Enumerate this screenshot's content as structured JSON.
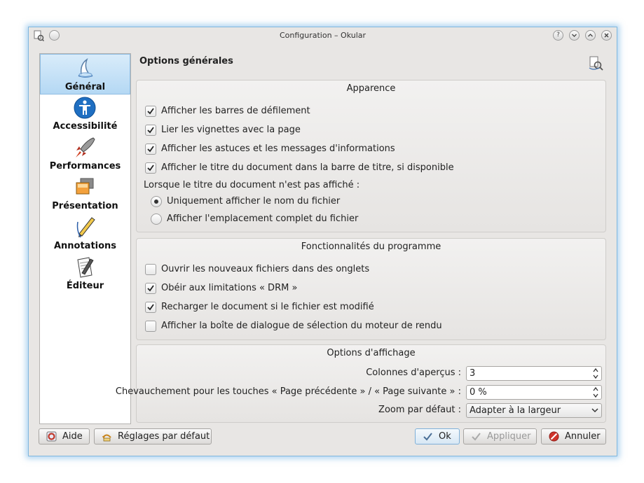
{
  "window": {
    "title": "Configuration – Okular"
  },
  "titlebar_buttons": [
    "help-icon",
    "minimize-icon",
    "maximize-icon",
    "close-icon"
  ],
  "sidebar": {
    "items": [
      {
        "label": "Général",
        "icon": "general-icon",
        "selected": true
      },
      {
        "label": "Accessibilité",
        "icon": "accessibility-icon",
        "selected": false
      },
      {
        "label": "Performances",
        "icon": "rocket-icon",
        "selected": false
      },
      {
        "label": "Présentation",
        "icon": "presentation-icon",
        "selected": false
      },
      {
        "label": "Annotations",
        "icon": "pencil-icon",
        "selected": false
      },
      {
        "label": "Éditeur",
        "icon": "editor-icon",
        "selected": false
      }
    ]
  },
  "page": {
    "title": "Options générales"
  },
  "appearance": {
    "title": "Apparence",
    "checkboxes": [
      {
        "label": "Afficher les barres de défilement",
        "checked": true
      },
      {
        "label": "Lier les vignettes avec la page",
        "checked": true
      },
      {
        "label": "Afficher les astuces et les messages d'informations",
        "checked": true
      },
      {
        "label": "Afficher le titre du document dans la barre de titre, si disponible",
        "checked": true
      }
    ],
    "radio_caption": "Lorsque le titre du document n'est pas affiché :",
    "radios": [
      {
        "label": "Uniquement afficher le nom du fichier",
        "selected": true
      },
      {
        "label": "Afficher l'emplacement complet du fichier",
        "selected": false
      }
    ]
  },
  "features": {
    "title": "Fonctionnalités du programme",
    "checkboxes": [
      {
        "label": "Ouvrir les nouveaux fichiers dans des onglets",
        "checked": false
      },
      {
        "label": "Obéir aux limitations « DRM »",
        "checked": true
      },
      {
        "label": "Recharger le document si le fichier est modifié",
        "checked": true
      },
      {
        "label": "Afficher la boîte de dialogue de sélection du moteur de rendu",
        "checked": false
      }
    ]
  },
  "display": {
    "title": "Options d'affichage",
    "thumb_columns": {
      "label": "Colonnes d'aperçus :",
      "value": "3"
    },
    "overlap": {
      "label": "Chevauchement pour les touches « Page précédente » / « Page suivante » :",
      "value": "0 %"
    },
    "zoom": {
      "label": "Zoom par défaut :",
      "value": "Adapter à la largeur"
    }
  },
  "buttons": {
    "help": "Aide",
    "defaults": "Réglages par défaut",
    "ok": "Ok",
    "apply": "Appliquer",
    "cancel": "Annuler"
  }
}
